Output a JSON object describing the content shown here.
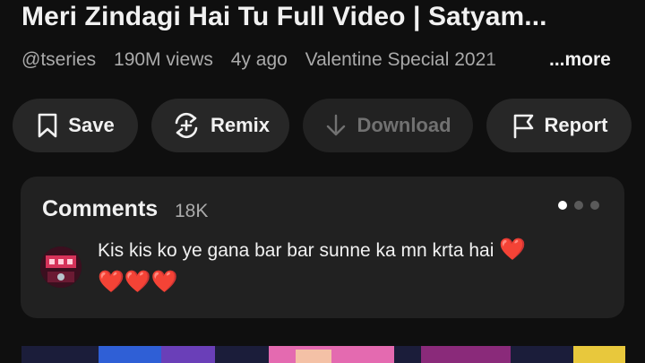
{
  "video": {
    "title": "Meri Zindagi Hai Tu Full Video | Satyam...",
    "channel": "@tseries",
    "views": "190M views",
    "age": "4y ago",
    "description_snippet": "Valentine Special 2021",
    "more_label": "...more"
  },
  "actions": [
    {
      "label": "Save",
      "icon": "bookmark-icon",
      "enabled": true
    },
    {
      "label": "Remix",
      "icon": "remix-icon",
      "enabled": true
    },
    {
      "label": "Download",
      "icon": "download-icon",
      "enabled": false
    },
    {
      "label": "Report",
      "icon": "flag-icon",
      "enabled": true
    }
  ],
  "comments": {
    "heading": "Comments",
    "count": "18K",
    "pager_dots": 3,
    "active_dot": 0,
    "top_comment": {
      "text": "Kis kis ko ye gana bar bar sunne ka mn krta hai",
      "emoji_inline": "❤️",
      "emoji_line2": "❤️❤️❤️"
    }
  },
  "colors": {
    "background": "#0f0f0f",
    "button_bg": "#272727",
    "card_bg": "#212121",
    "secondary_text": "#aaaaaa",
    "heart": "#e2202c"
  }
}
